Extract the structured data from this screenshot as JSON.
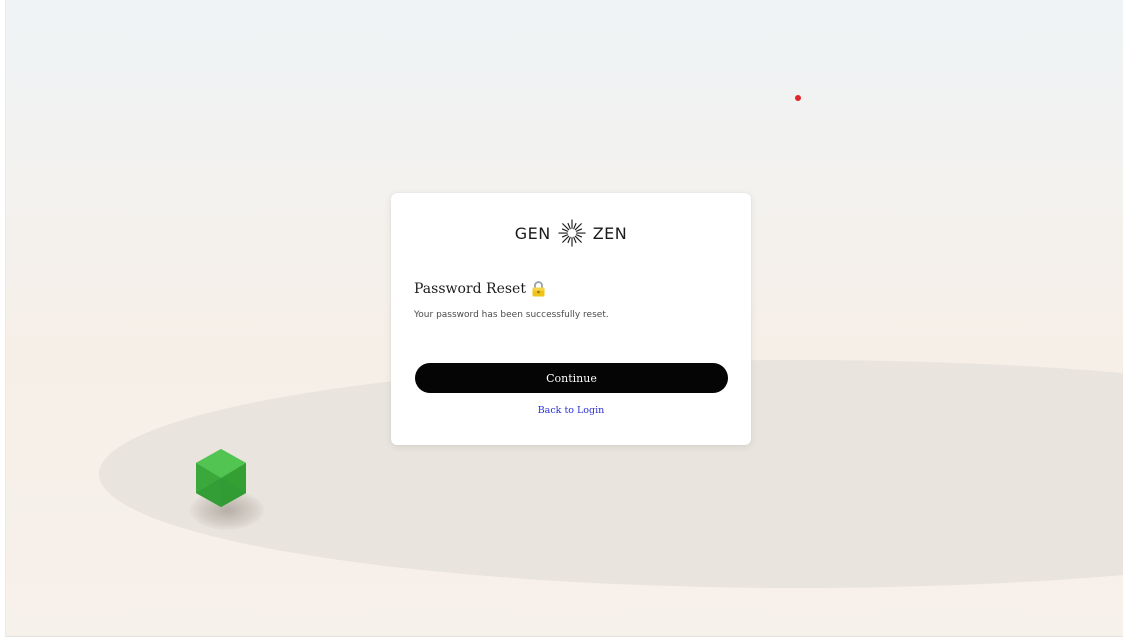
{
  "brand": {
    "left_word": "GEN",
    "right_word": "ZEN",
    "icon": "sunburst-logo-icon"
  },
  "reset": {
    "title": "Password Reset",
    "title_icon": "lock-icon",
    "message": "Your password has been successfully reset.",
    "continue_label": "Continue",
    "back_label": "Back to Login"
  },
  "colors": {
    "button_background": "#050505",
    "link": "#2a2fd6",
    "accent_dot": "#e0262b",
    "gem": "#3fae3f"
  }
}
